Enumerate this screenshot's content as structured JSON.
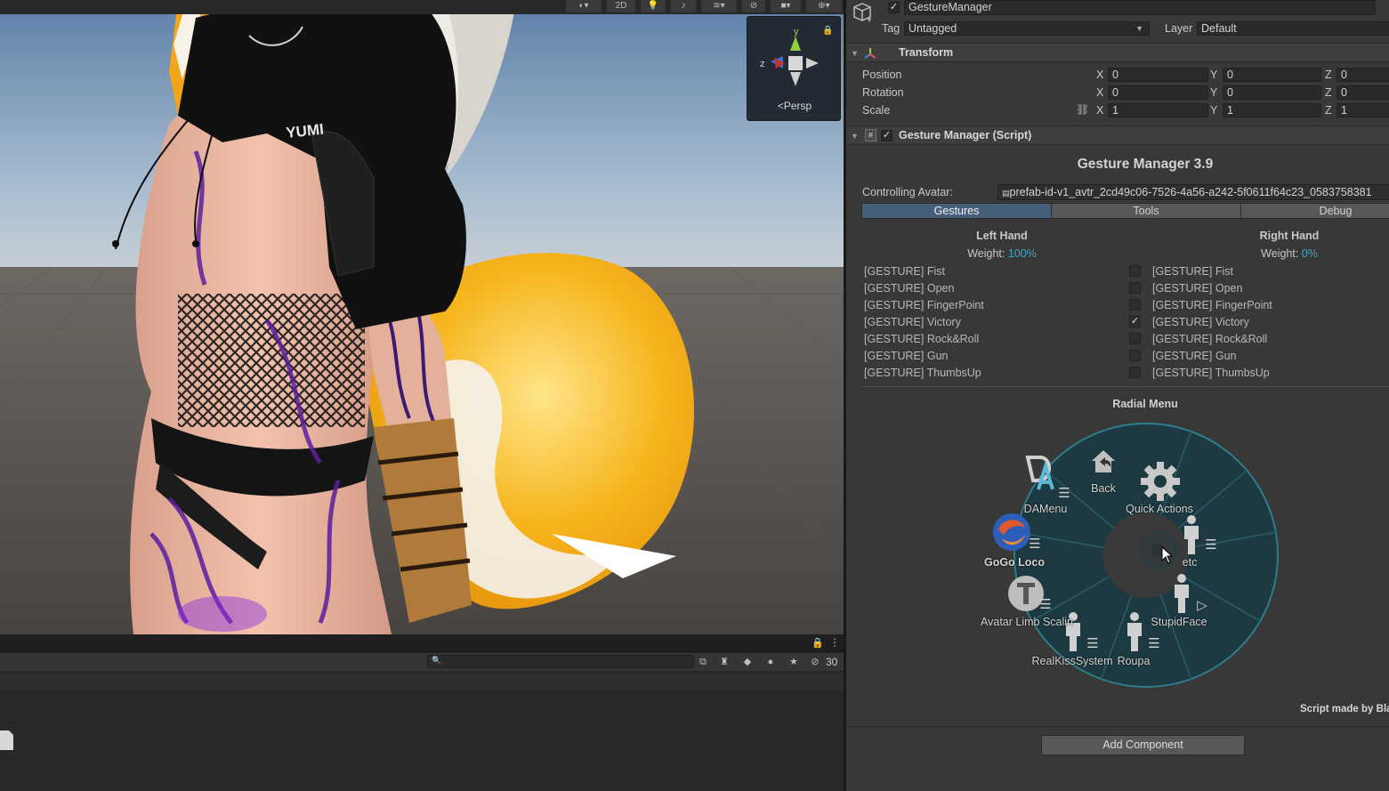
{
  "scene": {
    "toolbar": {
      "mode_2d": "2D",
      "hidden_count": "30"
    },
    "gizmo": {
      "projection": "Persp",
      "axis_y": "y",
      "axis_z": "z"
    },
    "shirt_text": "YUMI"
  },
  "inspector": {
    "object_name": "GestureManager",
    "tag_label": "Tag",
    "tag_value": "Untagged",
    "layer_label": "Layer",
    "layer_value": "Default",
    "transform": {
      "title": "Transform",
      "rows": [
        {
          "label": "Position",
          "x": "0",
          "y": "0",
          "z": "0"
        },
        {
          "label": "Rotation",
          "x": "0",
          "y": "0",
          "z": "0"
        },
        {
          "label": "Scale",
          "x": "1",
          "y": "1",
          "z": "1"
        }
      ],
      "axis": {
        "x": "X",
        "y": "Y",
        "z": "Z"
      }
    },
    "script": {
      "title": "Gesture Manager (Script)",
      "heading": "Gesture Manager 3.9",
      "controlling_label": "Controlling Avatar:",
      "controlling_value": "prefab-id-v1_avtr_2cd49c06-7526-4a56-a242-5f0611f64c23_0583758381",
      "tabs": [
        "Gestures",
        "Tools",
        "Debug"
      ],
      "left_hand": {
        "title": "Left Hand",
        "weight_label": "Weight:",
        "weight_value": "100%"
      },
      "right_hand": {
        "title": "Right Hand",
        "weight_label": "Weight:",
        "weight_value": "0%"
      },
      "gestures": [
        "[GESTURE] Fist",
        "[GESTURE] Open",
        "[GESTURE] FingerPoint",
        "[GESTURE] Victory",
        "[GESTURE] Rock&Roll",
        "[GESTURE] Gun",
        "[GESTURE] ThumbsUp"
      ],
      "checked_gesture": 3,
      "radial_title": "Radial Menu",
      "radial_items": [
        "Back",
        "Quick Actions",
        "etc",
        "StupidFace",
        "Roupa",
        "RealKissSystem",
        "Avatar Limb Scalin",
        "GoGo Loco",
        "DAMenu"
      ],
      "credits": "Script made by Bla",
      "add_component": "Add Component"
    }
  }
}
